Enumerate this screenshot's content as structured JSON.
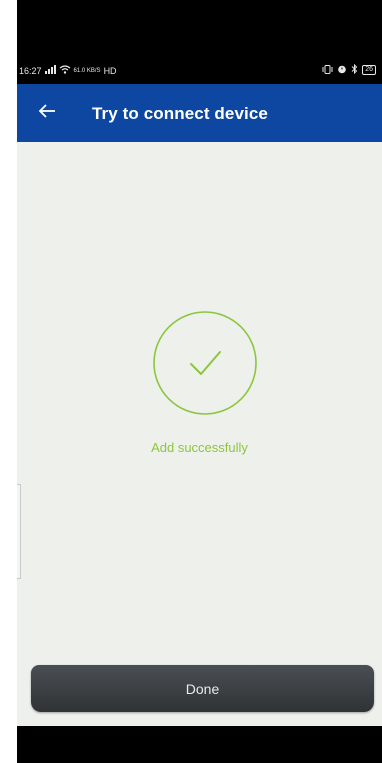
{
  "status_bar": {
    "time": "16:27",
    "signal_icon": "cell-signal-icon",
    "wifi_icon": "wifi-icon",
    "network_speed": "61.0 KB/S",
    "hd_label": "HD",
    "vibrate_icon": "vibrate-icon",
    "alarm_icon": "alarm-icon",
    "bluetooth_icon": "bluetooth-icon",
    "battery_level": "26"
  },
  "app_bar": {
    "back_icon": "back-arrow-icon",
    "title": "Try to connect device",
    "color": "#0d47a1"
  },
  "main": {
    "success_icon": "checkmark-circle-icon",
    "success_message": "Add successfully",
    "accent_color": "#8cc63f"
  },
  "footer": {
    "done_label": "Done"
  }
}
